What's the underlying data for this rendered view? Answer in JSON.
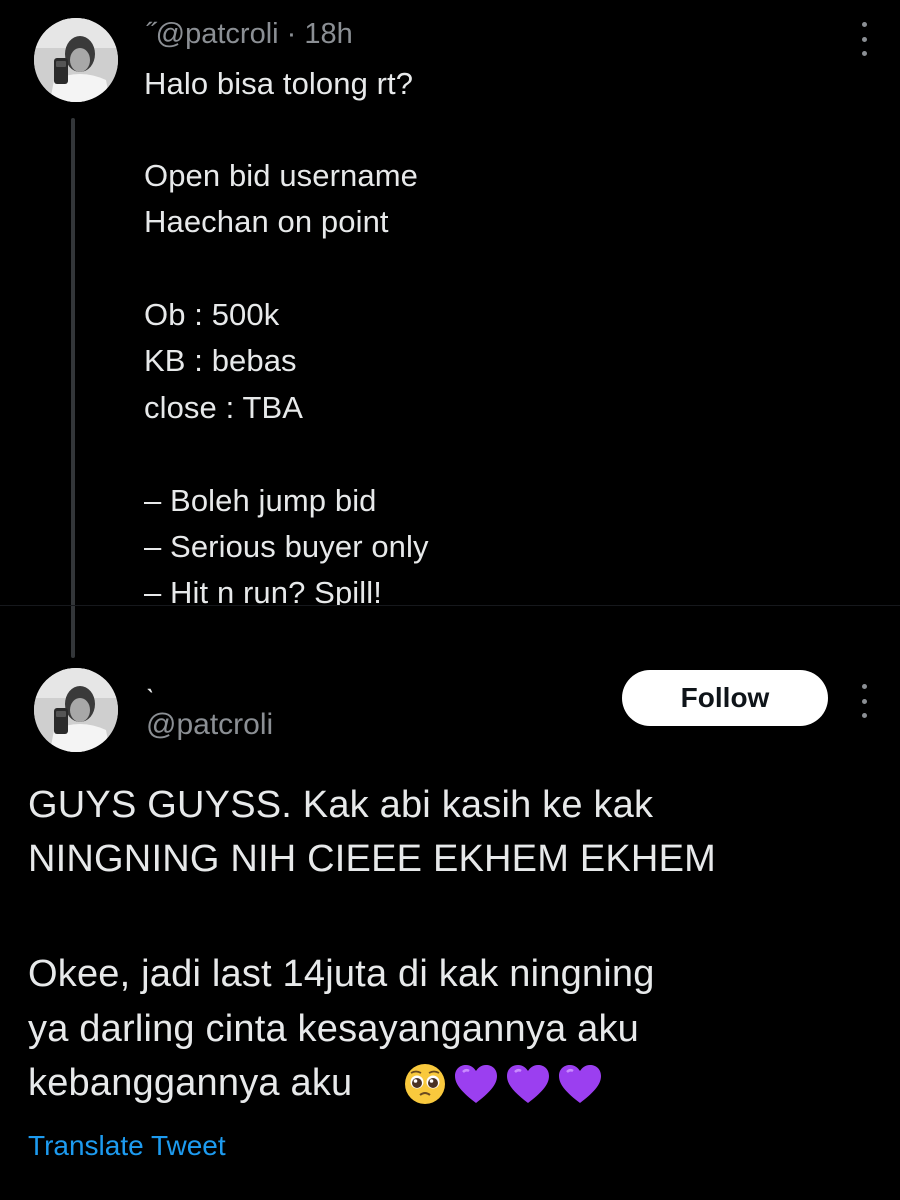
{
  "thread": {
    "parent_tweet": {
      "display_name_fragment": "˝",
      "handle": "@patcroli",
      "separator": "·",
      "time": "18h",
      "lines": [
        "Halo bisa tolong rt?",
        "",
        "Open bid username",
        "Haechan on point",
        "",
        "Ob : 500k",
        "KB : bebas",
        "close : TBA",
        "",
        "– Boleh jump bid",
        "– Serious buyer only",
        "– Hit n run? Spill!"
      ]
    },
    "main_tweet": {
      "display_name_fragment": "ˎ",
      "handle": "@patcroli",
      "follow_label": "Follow",
      "lines": [
        "GUYS GUYSS. Kak abi kasih ke kak",
        "NINGNING NIH CIEEE EKHEM EKHEM",
        "",
        "Okee, jadi last 14juta di kak ningning",
        "ya darling cinta kesayangannya aku",
        "kebanggannya aku"
      ],
      "emojis": [
        "pleading-face-emoji",
        "purple-heart-emoji",
        "purple-heart-emoji",
        "purple-heart-emoji"
      ],
      "translate_label": "Translate Tweet"
    }
  },
  "colors": {
    "background": "#000000",
    "text_primary": "#e7e9ea",
    "text_secondary": "#8b8f94",
    "link": "#1d9bf0",
    "thread_line": "#333639",
    "follow_bg": "#ffffff",
    "heart": "#9b3ff0"
  }
}
